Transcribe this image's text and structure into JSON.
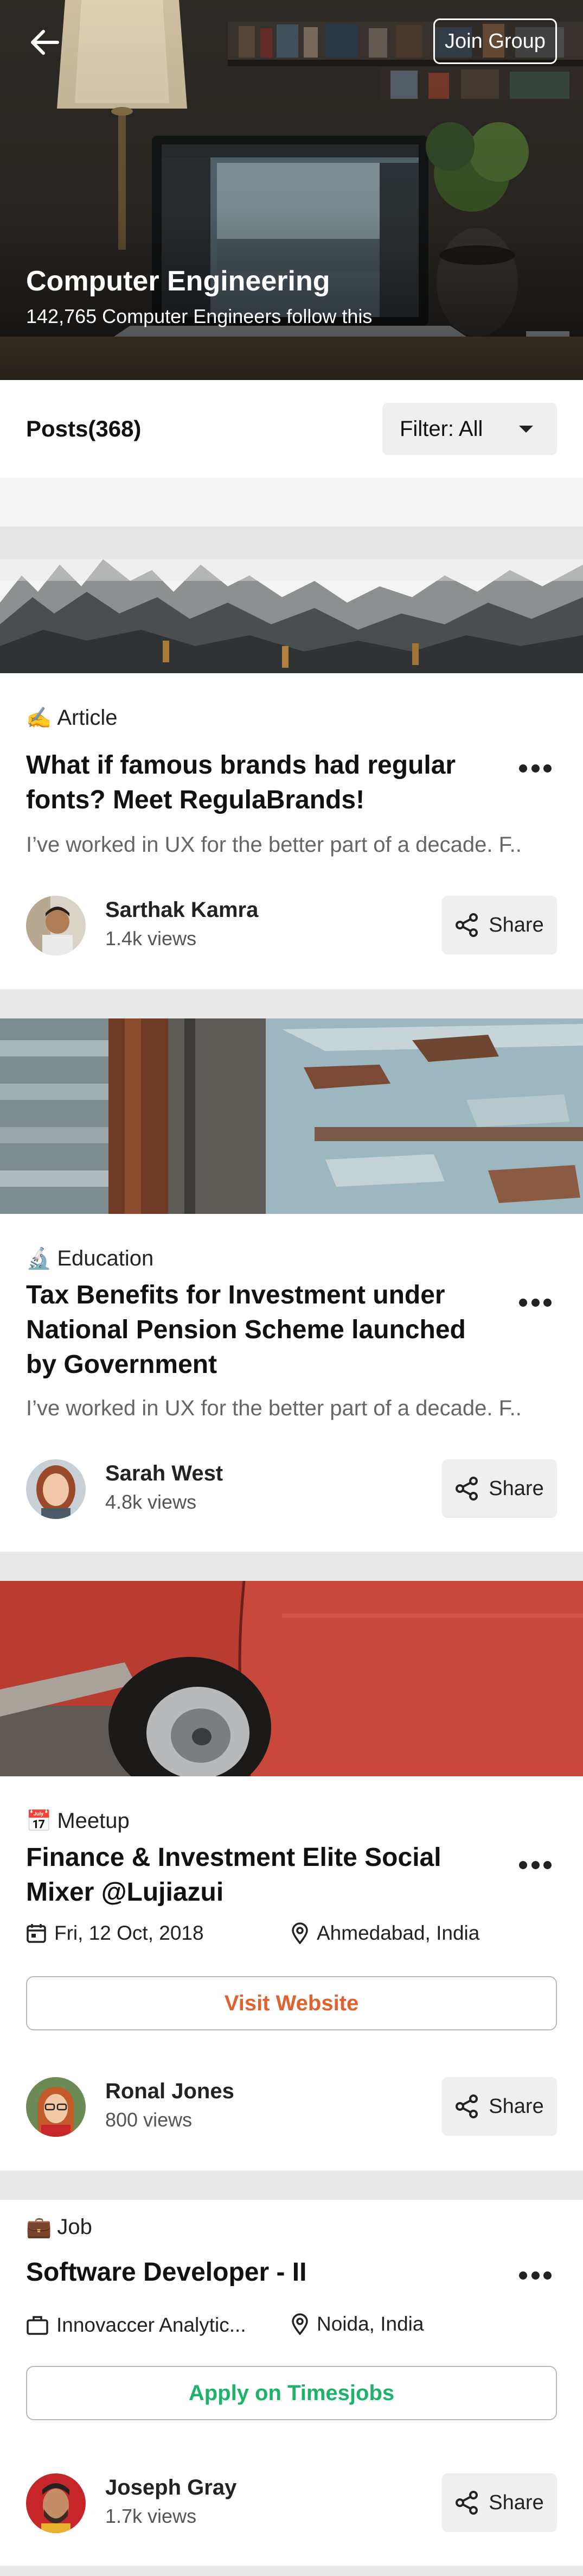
{
  "hero": {
    "title": "Computer Engineering",
    "subtitle": "142,765 Computer Engineers follow this",
    "join_label": "Join Group"
  },
  "posts": {
    "title": "Posts(368)",
    "filter_label": "Filter: All"
  },
  "cards": [
    {
      "category_icon": "writing-hand-icon",
      "category_emoji": "✍️",
      "category": "Article",
      "title": "What if famous brands had regular fonts? Meet RegulaBrands!",
      "excerpt": "I’ve worked in UX for the better part of a decade. F..",
      "author": "Sarthak Kamra",
      "views": "1.4k views",
      "share_label": "Share"
    },
    {
      "category_icon": "microscope-icon",
      "category_emoji": "🔬",
      "category": "Education",
      "title": "Tax Benefits for Investment under National Pension Scheme launched by Government",
      "excerpt": "I’ve worked in UX for the better part of a decade. F..",
      "author": "Sarah West",
      "views": "4.8k views",
      "share_label": "Share"
    },
    {
      "category_icon": "calendar-icon",
      "category_emoji": "📅",
      "category": "Meetup",
      "title": "Finance & Investment Elite Social Mixer @Lujiazui",
      "date": "Fri, 12 Oct, 2018",
      "location": "Ahmedabad, India",
      "action_label": "Visit Website",
      "action_color": "#e0622f",
      "author": "Ronal Jones",
      "views": "800 views",
      "share_label": "Share"
    },
    {
      "category_icon": "briefcase-icon",
      "category_emoji": "💼",
      "category": "Job",
      "title": "Software Developer - II",
      "company": "Innovaccer Analytic...",
      "location": "Noida, India",
      "action_label": "Apply on Timesjobs",
      "action_color": "#1db36a",
      "author": "Joseph Gray",
      "views": "1.7k views",
      "share_label": "Share"
    }
  ]
}
